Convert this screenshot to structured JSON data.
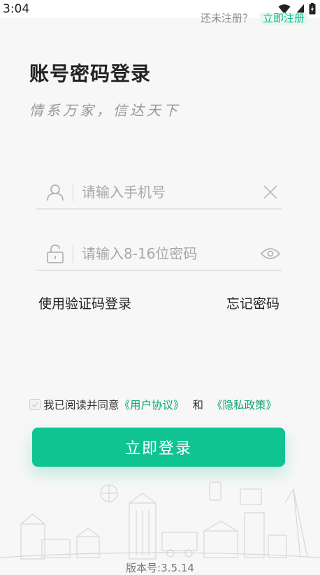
{
  "status_bar": {
    "time": "3:04"
  },
  "header": {
    "register_hint": "还未注册？",
    "register_link": "立即注册"
  },
  "page": {
    "title": "账号密码登录",
    "slogan": "情系万家，信达天下"
  },
  "form": {
    "phone_placeholder": "请输入手机号",
    "phone_value": "",
    "password_placeholder": "请输入8-16位密码",
    "password_value": ""
  },
  "links": {
    "sms_login": "使用验证码登录",
    "forgot_password": "忘记密码"
  },
  "agreement": {
    "prefix": "我已阅读并同意",
    "user_agreement": "《用户协议》",
    "and": "和",
    "privacy_policy": "《隐私政策》",
    "checked": false
  },
  "login_button": "立即登录",
  "footer": {
    "version": "版本号:3.5.14"
  },
  "colors": {
    "accent": "#10c393",
    "link": "#0aa56f",
    "background": "#f7f7f7"
  },
  "icons": [
    "wifi-icon",
    "signal-icon",
    "battery-icon",
    "user-icon",
    "clear-icon",
    "lock-icon",
    "eye-icon",
    "check-icon"
  ]
}
